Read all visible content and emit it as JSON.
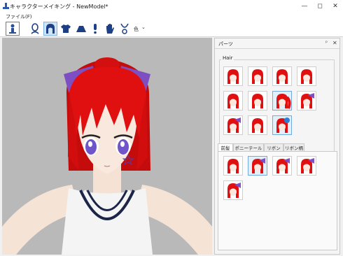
{
  "window": {
    "title": "キャラクターメイキング - NewModel*",
    "minimize_icon": "minimize-icon",
    "maximize_icon": "maximize-icon",
    "close_icon": "close-icon"
  },
  "menu": {
    "file": "ファイル(F)"
  },
  "toolbar": {
    "tools": [
      "body-icon",
      "head-icon",
      "hair-icon",
      "shirt-icon",
      "skirt-icon",
      "accessory-icon",
      "hand-icon",
      "necklace-icon"
    ],
    "color_label": "色",
    "dropdown_glyph": "⌄"
  },
  "panel": {
    "title": "パーツ",
    "pin_glyph": "ᵖ",
    "close_glyph": "✕",
    "hair_group_label": "Hair",
    "tabs": [
      "前髪",
      "ポニーテール",
      "リボン",
      "リボン柄"
    ],
    "active_tab": "前髪"
  },
  "colors": {
    "hair": "#e01010",
    "ribbon": "#7e4fc2",
    "selected": "#74a9dc"
  }
}
